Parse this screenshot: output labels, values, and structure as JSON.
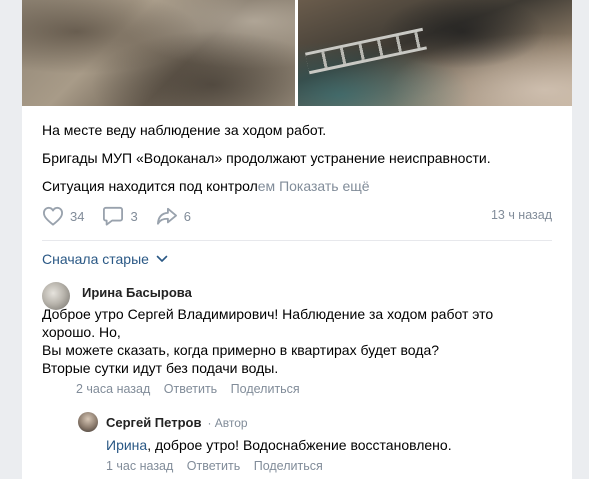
{
  "post": {
    "paragraphs": [
      "На месте веду наблюдение за ходом работ.",
      "Бригады МУП «Водоканал» продолжают устранение неисправности."
    ],
    "truncated_text": "Ситуация находится под контролем",
    "truncated_visible": "Ситуация находится под контрол",
    "truncated_faded": "ем",
    "show_more": "Показать ещё",
    "likes": "34",
    "comments": "3",
    "shares": "6",
    "time_ago": "13 ч назад",
    "icons": [
      "heart-icon",
      "comment-icon",
      "share-icon"
    ]
  },
  "comments_section": {
    "sort_label": "Сначала старые",
    "sort_icon": "chevron-down-icon",
    "items": [
      {
        "author": "Ирина Басырова",
        "text_lines": [
          "Доброе утро Сергей Владимирович! Наблюдение за ходом работ это",
          "хорошо. Но,",
          "Вы можете сказать, когда примерно в квартирах будет вода?",
          "Вторые сутки идут без подачи воды."
        ],
        "time": "2 часа назад",
        "reply": "Ответить",
        "share": "Поделиться"
      },
      {
        "author": "Сергей Петров",
        "role": "· Автор",
        "mention": "Ирина",
        "text": ", доброе утро! Водоснабжение восстановлено.",
        "time": "1 час назад",
        "reply": "Ответить",
        "share": "Поделиться"
      }
    ]
  },
  "colors": {
    "link": "#2a5885",
    "secondary": "#818c99",
    "divider": "#e7e8ec",
    "background": "#ebedf0"
  }
}
